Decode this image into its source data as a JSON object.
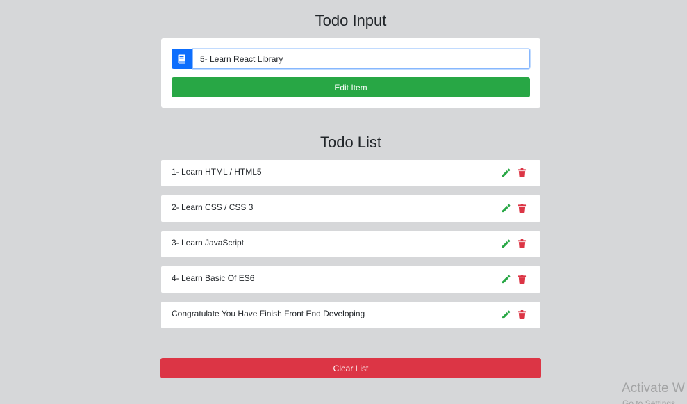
{
  "input_section": {
    "title": "Todo Input",
    "prefix_icon": "book-icon",
    "input_value": "5- Learn React Library",
    "submit_label": "Edit Item"
  },
  "list_section": {
    "title": "Todo List",
    "items": [
      {
        "text": "1- Learn HTML / HTML5"
      },
      {
        "text": "2- Learn CSS / CSS 3"
      },
      {
        "text": "3- Learn JavaScript"
      },
      {
        "text": "4- Learn Basic Of ES6"
      },
      {
        "text": "Congratulate You Have Finish Front End Developing"
      }
    ],
    "edit_icon": "pencil-icon",
    "delete_icon": "trash-icon",
    "clear_label": "Clear List"
  },
  "watermark": {
    "title": "Activate W",
    "subtitle": "Go to Settings"
  },
  "colors": {
    "background": "#d6d7d9",
    "primary": "#0d6efd",
    "success": "#28a745",
    "danger": "#dc3545"
  }
}
